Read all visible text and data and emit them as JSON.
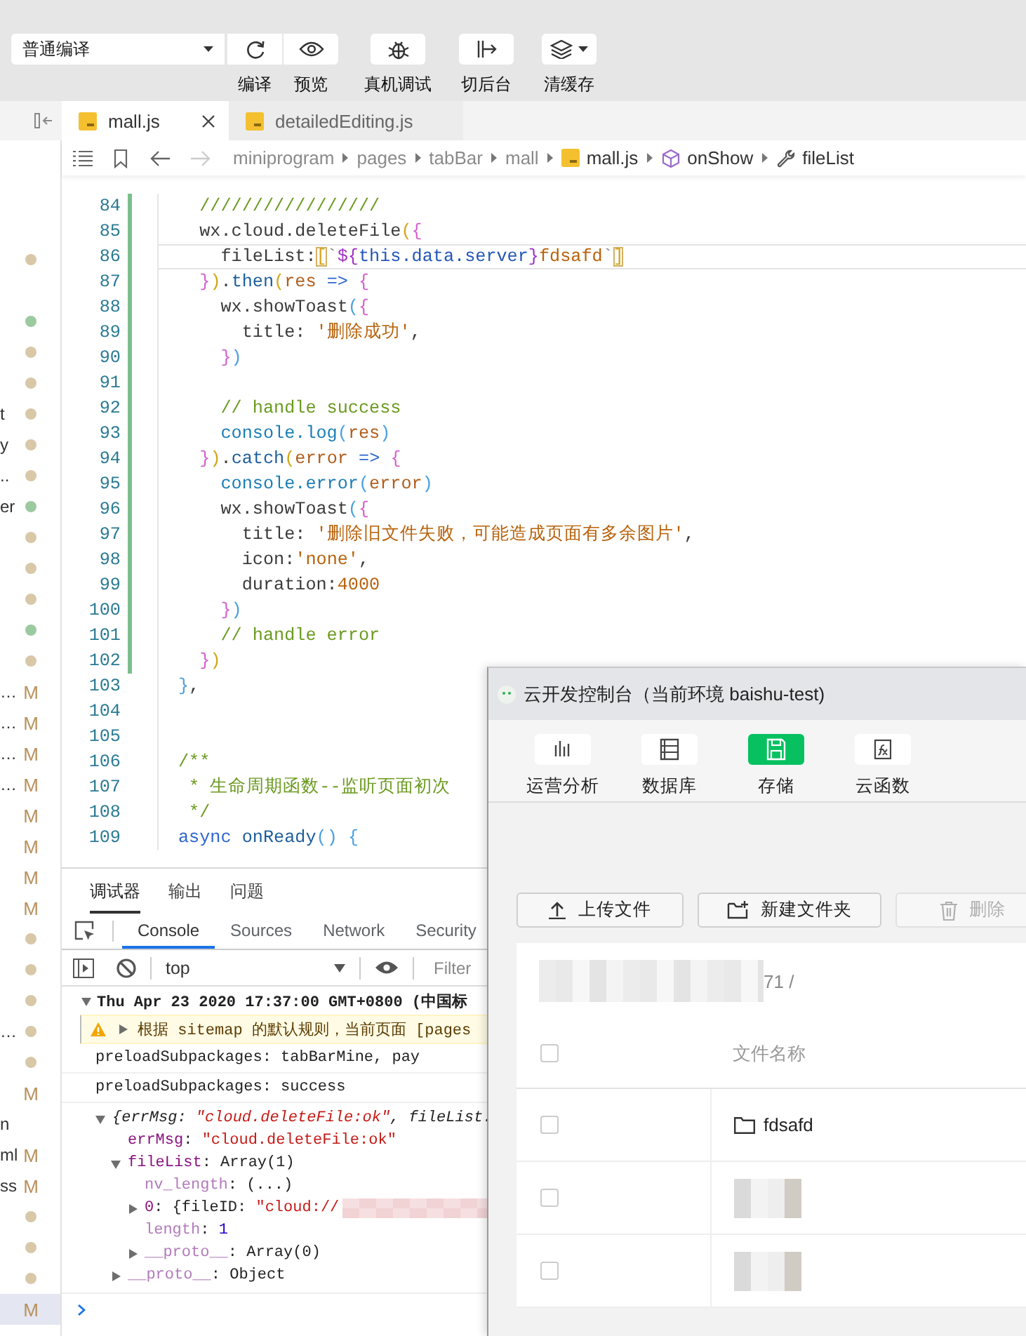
{
  "toolbar": {
    "compile_mode": "普通编译",
    "buttons": [
      {
        "label": "编译"
      },
      {
        "label": "预览"
      },
      {
        "label": "真机调试"
      },
      {
        "label": "切后台"
      },
      {
        "label": "清缓存"
      }
    ]
  },
  "tabs": [
    {
      "label": "mall.js",
      "selected": true
    },
    {
      "label": "detailedEditing.js",
      "selected": false
    }
  ],
  "sidebar": {
    "items": [
      {
        "kind": "dot",
        "color": "#d8c8a8",
        "selected": false
      },
      {
        "kind": "blank",
        "selected": false
      },
      {
        "kind": "dot",
        "color": "#9ccaa0",
        "selected": false
      },
      {
        "kind": "dot",
        "color": "#d8c8a8",
        "selected": false
      },
      {
        "kind": "dot",
        "color": "#d8c8a8",
        "selected": false
      },
      {
        "text": "t",
        "kind": "dot",
        "color": "#d8c8a8",
        "selected": false
      },
      {
        "text": "y",
        "kind": "dot",
        "color": "#d8c8a8",
        "selected": false
      },
      {
        "text": "..",
        "kind": "dot",
        "color": "#d8c8a8",
        "selected": false
      },
      {
        "text": "er",
        "kind": "dot",
        "color": "#9ccaa0",
        "selected": false
      },
      {
        "kind": "dot",
        "color": "#d8c8a8",
        "selected": false
      },
      {
        "kind": "dot",
        "color": "#d8c8a8",
        "selected": false
      },
      {
        "kind": "dot",
        "color": "#d8c8a8",
        "selected": false
      },
      {
        "kind": "dot",
        "color": "#9ccaa0",
        "selected": false
      },
      {
        "kind": "dot",
        "color": "#d8c8a8",
        "selected": false
      },
      {
        "text": "…",
        "kind": "badge",
        "badge": "M",
        "selected": false
      },
      {
        "text": "…",
        "kind": "badge",
        "badge": "M",
        "selected": false
      },
      {
        "text": "…",
        "kind": "badge",
        "badge": "M",
        "selected": false
      },
      {
        "text": "…",
        "kind": "badge",
        "badge": "M",
        "selected": false
      },
      {
        "kind": "badge",
        "badge": "M",
        "selected": false
      },
      {
        "kind": "badge",
        "badge": "M",
        "selected": false
      },
      {
        "kind": "badge",
        "badge": "M",
        "selected": false
      },
      {
        "kind": "badge",
        "badge": "M",
        "selected": false
      },
      {
        "kind": "dot",
        "color": "#d8c8a8",
        "selected": false
      },
      {
        "kind": "dot",
        "color": "#d8c8a8",
        "selected": false
      },
      {
        "kind": "dot",
        "color": "#d8c8a8",
        "selected": false
      },
      {
        "text": "…",
        "kind": "dot",
        "color": "#d8c8a8",
        "selected": false
      },
      {
        "kind": "dot",
        "color": "#d8c8a8",
        "selected": false
      },
      {
        "kind": "badge",
        "badge": "M",
        "selected": false
      },
      {
        "text": "n",
        "kind": "blank",
        "selected": false
      },
      {
        "text": "ml",
        "kind": "badge",
        "badge": "M",
        "selected": false
      },
      {
        "text": "ss",
        "kind": "badge",
        "badge": "M",
        "selected": false
      },
      {
        "kind": "dot",
        "color": "#d8c8a8",
        "selected": false
      },
      {
        "kind": "dot",
        "color": "#d8c8a8",
        "selected": false
      },
      {
        "kind": "dot",
        "color": "#d8c8a8",
        "selected": false
      },
      {
        "kind": "badge",
        "badge": "M",
        "selected": true
      }
    ]
  },
  "breadcrumb": [
    {
      "text": "miniprogram",
      "kind": "folder"
    },
    {
      "text": "pages",
      "kind": "folder"
    },
    {
      "text": "tabBar",
      "kind": "folder"
    },
    {
      "text": "mall",
      "kind": "folder"
    },
    {
      "text": "mall.js",
      "kind": "file"
    },
    {
      "text": "onShow",
      "kind": "method"
    },
    {
      "text": "fileList",
      "kind": "property"
    }
  ],
  "editor": {
    "lines": [
      {
        "number": "84",
        "changed": true,
        "current": false,
        "tokens": [
          {
            "kind": "c",
            "text": "  /////////////////"
          }
        ]
      },
      {
        "number": "85",
        "changed": true,
        "current": false,
        "tokens": [
          {
            "kind": "t",
            "text": "  wx.cloud.deleteFile"
          },
          {
            "kind": "pY",
            "text": "("
          },
          {
            "kind": "pP",
            "text": "{"
          }
        ]
      },
      {
        "number": "86",
        "changed": true,
        "current": true,
        "tokens": [
          {
            "kind": "t",
            "text": "    fileList:"
          },
          {
            "kind": "mt",
            "text": "["
          },
          {
            "kind": "g",
            "text": "`"
          },
          {
            "kind": "tp",
            "text": "${"
          },
          {
            "kind": "tb",
            "text": "this.data.server"
          },
          {
            "kind": "tp",
            "text": "}"
          },
          {
            "kind": "s",
            "text": "fdsafd"
          },
          {
            "kind": "g",
            "text": "`"
          },
          {
            "kind": "mt",
            "text": "]"
          }
        ]
      },
      {
        "number": "87",
        "changed": true,
        "current": false,
        "tokens": [
          {
            "kind": "pP",
            "text": "  }"
          },
          {
            "kind": "pY",
            "text": ")"
          },
          {
            "kind": "t",
            "text": "."
          },
          {
            "kind": "m",
            "text": "then"
          },
          {
            "kind": "pY",
            "text": "("
          },
          {
            "kind": "v",
            "text": "res "
          },
          {
            "kind": "k",
            "text": "=> "
          },
          {
            "kind": "pP",
            "text": "{"
          }
        ]
      },
      {
        "number": "88",
        "changed": true,
        "current": false,
        "tokens": [
          {
            "kind": "t",
            "text": "    wx.showToast"
          },
          {
            "kind": "pB",
            "text": "("
          },
          {
            "kind": "pP",
            "text": "{"
          }
        ]
      },
      {
        "number": "89",
        "changed": true,
        "current": false,
        "tokens": [
          {
            "kind": "t",
            "text": "      title: "
          },
          {
            "kind": "s",
            "text": "'删除成功'"
          },
          {
            "kind": "t",
            "text": ","
          }
        ]
      },
      {
        "number": "90",
        "changed": true,
        "current": false,
        "tokens": [
          {
            "kind": "pP",
            "text": "    }"
          },
          {
            "kind": "pB",
            "text": ")"
          }
        ]
      },
      {
        "number": "91",
        "changed": true,
        "current": false
      },
      {
        "number": "92",
        "changed": true,
        "current": false,
        "tokens": [
          {
            "kind": "c",
            "text": "    // handle success"
          }
        ]
      },
      {
        "number": "93",
        "changed": true,
        "current": false,
        "tokens": [
          {
            "kind": "f",
            "text": "    console.log"
          },
          {
            "kind": "pB",
            "text": "("
          },
          {
            "kind": "v",
            "text": "res"
          },
          {
            "kind": "pB",
            "text": ")"
          }
        ]
      },
      {
        "number": "94",
        "changed": true,
        "current": false,
        "tokens": [
          {
            "kind": "pP",
            "text": "  }"
          },
          {
            "kind": "pY",
            "text": ")"
          },
          {
            "kind": "t",
            "text": "."
          },
          {
            "kind": "m",
            "text": "catch"
          },
          {
            "kind": "pY",
            "text": "("
          },
          {
            "kind": "v",
            "text": "error "
          },
          {
            "kind": "k",
            "text": "=> "
          },
          {
            "kind": "pP",
            "text": "{"
          }
        ]
      },
      {
        "number": "95",
        "changed": true,
        "current": false,
        "tokens": [
          {
            "kind": "f",
            "text": "    console.error"
          },
          {
            "kind": "pB",
            "text": "("
          },
          {
            "kind": "v",
            "text": "error"
          },
          {
            "kind": "pB",
            "text": ")"
          }
        ]
      },
      {
        "number": "96",
        "changed": true,
        "current": false,
        "tokens": [
          {
            "kind": "t",
            "text": "    wx.showToast"
          },
          {
            "kind": "pB",
            "text": "("
          },
          {
            "kind": "pP",
            "text": "{"
          }
        ]
      },
      {
        "number": "97",
        "changed": true,
        "current": false,
        "tokens": [
          {
            "kind": "t",
            "text": "      title: "
          },
          {
            "kind": "s",
            "text": "'删除旧文件失败，可能造成页面有多余图片'"
          },
          {
            "kind": "t",
            "text": ","
          }
        ]
      },
      {
        "number": "98",
        "changed": true,
        "current": false,
        "tokens": [
          {
            "kind": "t",
            "text": "      icon:"
          },
          {
            "kind": "s",
            "text": "'none'"
          },
          {
            "kind": "t",
            "text": ","
          }
        ]
      },
      {
        "number": "99",
        "changed": true,
        "current": false,
        "tokens": [
          {
            "kind": "t",
            "text": "      duration:"
          },
          {
            "kind": "n",
            "text": "4000"
          }
        ]
      },
      {
        "number": "100",
        "changed": true,
        "current": false,
        "tokens": [
          {
            "kind": "pP",
            "text": "    }"
          },
          {
            "kind": "pB",
            "text": ")"
          }
        ]
      },
      {
        "number": "101",
        "changed": true,
        "current": false,
        "tokens": [
          {
            "kind": "c",
            "text": "    // handle error"
          }
        ]
      },
      {
        "number": "102",
        "changed": true,
        "current": false,
        "tokens": [
          {
            "kind": "pP",
            "text": "  }"
          },
          {
            "kind": "pY",
            "text": ")"
          }
        ]
      },
      {
        "number": "103",
        "changed": false,
        "current": false,
        "tokens": [
          {
            "kind": "pB",
            "text": "}"
          },
          {
            "kind": "t",
            "text": ","
          }
        ]
      },
      {
        "number": "104",
        "changed": false,
        "current": false
      },
      {
        "number": "105",
        "changed": false,
        "current": false
      },
      {
        "number": "106",
        "changed": false,
        "current": false,
        "tokens": [
          {
            "kind": "c",
            "text": "/**"
          }
        ]
      },
      {
        "number": "107",
        "changed": false,
        "current": false,
        "tokens": [
          {
            "kind": "c",
            "text": " * 生命周期函数--监听页面初次"
          }
        ]
      },
      {
        "number": "108",
        "changed": false,
        "current": false,
        "tokens": [
          {
            "kind": "c",
            "text": " */"
          }
        ]
      },
      {
        "number": "109",
        "changed": false,
        "current": false,
        "tokens": [
          {
            "kind": "k",
            "text": "async "
          },
          {
            "kind": "m",
            "text": "onReady"
          },
          {
            "kind": "pB",
            "text": "() {"
          }
        ]
      }
    ]
  },
  "panel": {
    "tabs": [
      {
        "label": "调试器",
        "selected": true
      },
      {
        "label": "输出",
        "selected": false
      },
      {
        "label": "问题",
        "selected": false
      }
    ],
    "devtools_tabs": [
      {
        "label": "Console",
        "selected": true
      },
      {
        "label": "Sources",
        "selected": false
      },
      {
        "label": "Network",
        "selected": false
      },
      {
        "label": "Security",
        "selected": false
      }
    ],
    "context": "top",
    "filter": {
      "placeholder": "Filter"
    },
    "messages": [
      {
        "kind": "group",
        "expanded": true,
        "text": "Thu Apr 23 2020 17:37:00 GMT+0800 (中国标"
      },
      {
        "kind": "warning",
        "expanded": false,
        "text": "根据 sitemap 的默认规则，当前页面 [pages"
      },
      {
        "kind": "log",
        "text": "preloadSubpackages: tabBarMine, pay"
      },
      {
        "kind": "log",
        "text": "preloadSubpackages: success"
      },
      {
        "kind": "object",
        "expanded": true,
        "preview": [
          {
            "kind": "plain",
            "text": "{errMsg: "
          },
          {
            "kind": "string",
            "text": "\"cloud.deleteFile:ok\""
          },
          {
            "kind": "plain",
            "text": ", fileList:"
          }
        ],
        "children": [
          {
            "key": "errMsg",
            "dim": false,
            "value": [
              {
                "kind": "plain",
                "text": ": "
              },
              {
                "kind": "string",
                "text": "\"cloud.deleteFile:ok\""
              }
            ]
          },
          {
            "key": "fileList",
            "dim": false,
            "expanded": true,
            "value": [
              {
                "kind": "plain",
                "text": ": Array(1)"
              }
            ],
            "children": [
              {
                "key": "nv_length",
                "dim": true,
                "value": [
                  {
                    "kind": "plain",
                    "text": ": (...)"
                  }
                ]
              },
              {
                "key": "0",
                "dim": false,
                "expanded": false,
                "redacted": true,
                "value": [
                  {
                    "kind": "plain",
                    "text": ": {fileID: "
                  },
                  {
                    "kind": "string",
                    "text": "\"cloud://"
                  }
                ]
              },
              {
                "key": "length",
                "dim": true,
                "value": [
                  {
                    "kind": "plain",
                    "text": ": "
                  },
                  {
                    "kind": "number",
                    "text": "1"
                  }
                ]
              },
              {
                "key": "__proto__",
                "dim": true,
                "expanded": false,
                "value": [
                  {
                    "kind": "plain",
                    "text": ": Array(0)"
                  }
                ]
              }
            ]
          },
          {
            "key": "__proto__",
            "dim": true,
            "expanded": false,
            "value": [
              {
                "kind": "plain",
                "text": ": Object"
              }
            ]
          }
        ]
      }
    ]
  },
  "cloud_console": {
    "title": "云开发控制台（当前环境 baishu-test)",
    "nav": [
      {
        "label": "运营分析",
        "selected": false
      },
      {
        "label": "数据库",
        "selected": false
      },
      {
        "label": "存储",
        "selected": true
      },
      {
        "label": "云函数",
        "selected": false
      }
    ],
    "actions": [
      {
        "label": "上传文件",
        "disabled": false
      },
      {
        "label": "新建文件夹",
        "disabled": false
      },
      {
        "label": "删除",
        "disabled": true
      }
    ],
    "path": "71 /",
    "table": {
      "all_checked": false,
      "columns": [
        "文件名称"
      ],
      "rows": [
        {
          "checked": false,
          "kind": "folder",
          "name": "fdsafd"
        },
        {
          "checked": false,
          "kind": "redacted"
        },
        {
          "checked": false,
          "kind": "redacted"
        }
      ]
    }
  }
}
